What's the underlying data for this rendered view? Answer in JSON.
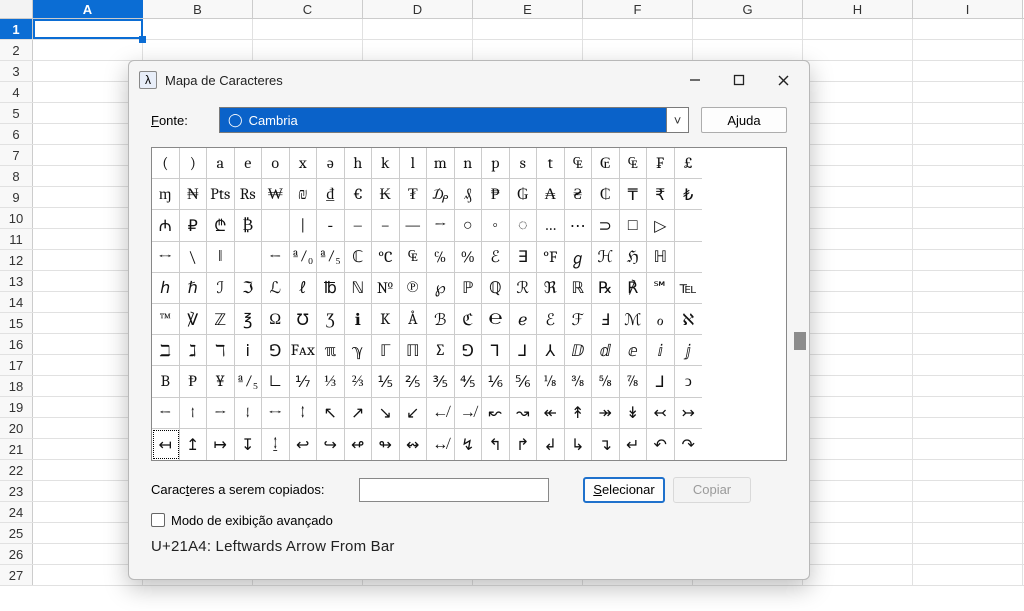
{
  "sheet": {
    "columns": [
      "A",
      "B",
      "C",
      "D",
      "E",
      "F",
      "G",
      "H",
      "I"
    ],
    "row_count": 27,
    "active_row": 1,
    "active_col": 0
  },
  "dialog": {
    "title": "Mapa de Caracteres",
    "font_label": "Fonte:",
    "font_value": "Cambria",
    "help_label": "Ajuda",
    "copy_label": "Caracteres a serem copiados:",
    "copy_value": "",
    "select_label": "Selecionar",
    "copy_btn_label": "Copiar",
    "advanced_label": "Modo de exibição avançado",
    "status": "U+21A4: Leftwards Arrow From Bar",
    "selected_index": 180,
    "chars": [
      "(",
      ")",
      "a",
      "e",
      "o",
      "x",
      "ə",
      "h",
      "k",
      "l",
      "m",
      "n",
      "p",
      "s",
      "t",
      "₠",
      "₢",
      "₠",
      "₣",
      "£",
      "ɱ",
      "₦",
      "Pts",
      "Rs",
      "₩",
      "₪",
      "₫",
      "€",
      "₭",
      "₮",
      "₯",
      "₰",
      "₱",
      "₲",
      "₳",
      "₴",
      "₵",
      "₸",
      "₹",
      "₺",
      "₼",
      "₽",
      "₾",
      "₿",
      "",
      "|",
      "‐",
      "‒",
      "–",
      "—",
      "→",
      "○",
      "◦",
      "◌",
      "…",
      "⋯",
      "⊃",
      "□",
      "▷",
      "",
      "↔",
      "\\",
      "‖",
      "",
      "←",
      "ª⁄₀",
      "ª⁄₅",
      "ℂ",
      "°C",
      "₠",
      "℅",
      "%",
      "ℰ",
      "∃",
      "°F",
      "ℊ",
      "ℋ",
      "ℌ",
      "ℍ",
      "",
      "ℎ",
      "ℏ",
      "ℐ",
      "ℑ",
      "ℒ",
      "ℓ",
      "℔",
      "ℕ",
      "№",
      "℗",
      "℘",
      "ℙ",
      "ℚ",
      "ℛ",
      "ℜ",
      "ℝ",
      "℞",
      "℟",
      "℠",
      "℡",
      "™",
      "℣",
      "ℤ",
      "℥",
      "Ω",
      "℧",
      "Ʒ",
      "ℹ",
      "K",
      "Å",
      "ℬ",
      "ℭ",
      "℮",
      "ℯ",
      "ℰ",
      "ℱ",
      "Ⅎ",
      "ℳ",
      "ℴ",
      "ℵ",
      "ℶ",
      "ℷ",
      "ℸ",
      "ⅰ",
      "⅁",
      "Fᴀx",
      "ℼ",
      "ℽ",
      "ℾ",
      "ℿ",
      "∑",
      "⅁",
      "⅂",
      "⅃",
      "⅄",
      "ⅅ",
      "ⅆ",
      "ⅇ",
      "ⅈ",
      "ⅉ",
      "B",
      "Ᵽ",
      "¥",
      "ª⁄₅",
      "∟",
      "⅐",
      "⅓",
      "⅔",
      "⅕",
      "⅖",
      "⅗",
      "⅘",
      "⅙",
      "⅚",
      "⅛",
      "⅜",
      "⅝",
      "⅞",
      "⅃",
      "ↄ",
      "←",
      "↑",
      "→",
      "↓",
      "↔",
      "↕",
      "↖",
      "↗",
      "↘",
      "↙",
      "↚",
      "↛",
      "↜",
      "↝",
      "↞",
      "↟",
      "↠",
      "↡",
      "↢",
      "↣",
      "↤",
      "↥",
      "↦",
      "↧",
      "↨",
      "↩",
      "↪",
      "↫",
      "↬",
      "↭",
      "↮",
      "↯",
      "↰",
      "↱",
      "↲",
      "↳",
      "↴",
      "↵",
      "↶",
      "↷"
    ]
  }
}
